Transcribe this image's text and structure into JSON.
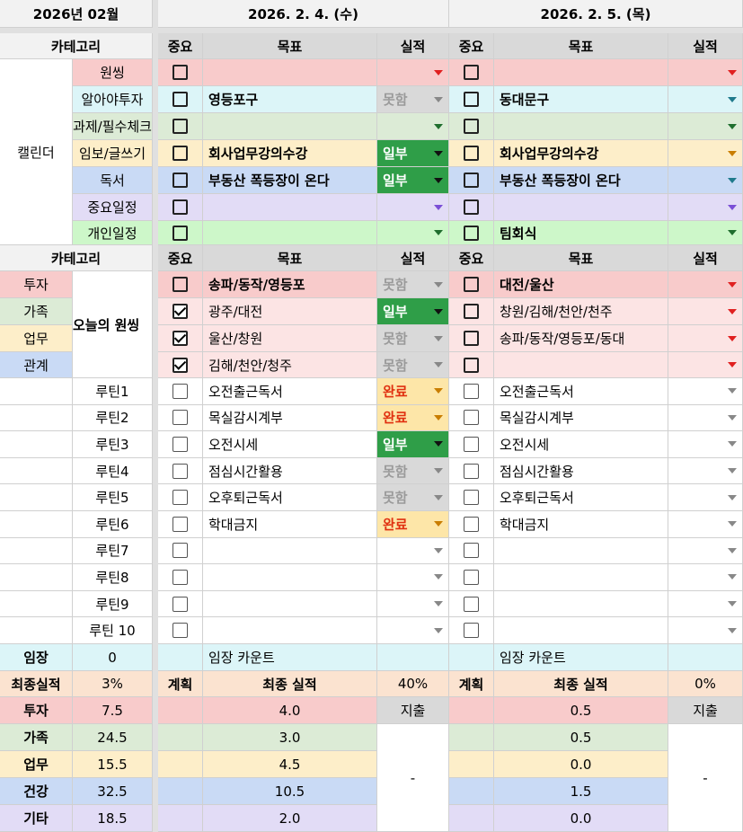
{
  "header": {
    "month": "2026년 02월",
    "day1": "2026. 2. 4. (수)",
    "day2": "2026. 2. 5. (목)"
  },
  "cols": {
    "category": "카테고리",
    "important": "중요",
    "goal": "목표",
    "result": "실적"
  },
  "calendar": {
    "label": "캘린더",
    "rows": [
      {
        "name": "원씽",
        "d1_goal": "",
        "d1_result": "",
        "d2_goal": "",
        "d2_result": ""
      },
      {
        "name": "알아야투자",
        "d1_goal": "영등포구",
        "d1_result": "못함",
        "d2_goal": "동대문구",
        "d2_result": ""
      },
      {
        "name": "과제/필수체크",
        "d1_goal": "",
        "d1_result": "",
        "d2_goal": "",
        "d2_result": ""
      },
      {
        "name": "임보/글쓰기",
        "d1_goal": "회사업무강의수강",
        "d1_result": "일부",
        "d2_goal": "회사업무강의수강",
        "d2_result": ""
      },
      {
        "name": "독서",
        "d1_goal": "부동산 폭등장이 온다",
        "d1_result": "일부",
        "d2_goal": "부동산 폭등장이 온다",
        "d2_result": ""
      },
      {
        "name": "중요일정",
        "d1_goal": "",
        "d1_result": "",
        "d2_goal": "",
        "d2_result": ""
      },
      {
        "name": "개인일정",
        "d1_goal": "",
        "d1_result": "",
        "d2_goal": "팀회식",
        "d2_result": ""
      }
    ]
  },
  "oneThing": {
    "label": "오늘의 원씽",
    "legend": [
      "투자",
      "가족",
      "업무",
      "관계"
    ],
    "rows": [
      {
        "d1_goal": "송파/동작/영등포",
        "d1_result": "못함",
        "d1_checked": false,
        "d2_goal": "대전/울산",
        "d2_checked": false
      },
      {
        "d1_goal": "광주/대전",
        "d1_result": "일부",
        "d1_checked": true,
        "d2_goal": "창원/김해/천안/천주",
        "d2_checked": false
      },
      {
        "d1_goal": "울산/창원",
        "d1_result": "못함",
        "d1_checked": true,
        "d2_goal": "송파/동작/영등포/동대",
        "d2_checked": false
      },
      {
        "d1_goal": "김해/천안/청주",
        "d1_result": "못함",
        "d1_checked": true,
        "d2_goal": "",
        "d2_checked": false
      }
    ]
  },
  "routines": [
    {
      "name": "루틴1",
      "d1_goal": "오전출근독서",
      "d1_result": "완료",
      "d2_goal": "오전출근독서"
    },
    {
      "name": "루틴2",
      "d1_goal": "목실감시계부",
      "d1_result": "완료",
      "d2_goal": "목실감시계부"
    },
    {
      "name": "루틴3",
      "d1_goal": "오전시세",
      "d1_result": "일부",
      "d2_goal": "오전시세"
    },
    {
      "name": "루틴4",
      "d1_goal": "점심시간활용",
      "d1_result": "못함",
      "d2_goal": "점심시간활용"
    },
    {
      "name": "루틴5",
      "d1_goal": "오후퇴근독서",
      "d1_result": "못함",
      "d2_goal": "오후퇴근독서"
    },
    {
      "name": "루틴6",
      "d1_goal": "학대금지",
      "d1_result": "완료",
      "d2_goal": "학대금지"
    },
    {
      "name": "루틴7",
      "d1_goal": "",
      "d1_result": "",
      "d2_goal": ""
    },
    {
      "name": "루틴8",
      "d1_goal": "",
      "d1_result": "",
      "d2_goal": ""
    },
    {
      "name": "루틴9",
      "d1_goal": "",
      "d1_result": "",
      "d2_goal": ""
    },
    {
      "name": "루틴 10",
      "d1_goal": "",
      "d1_result": "",
      "d2_goal": ""
    }
  ],
  "imjang": {
    "label": "임장",
    "value": "0",
    "d1_text": "임장 카운트",
    "d2_text": "임장 카운트"
  },
  "final": {
    "label": "최종실적",
    "value": "3%",
    "plan": "계획",
    "title": "최종 실적",
    "d1_pct": "40%",
    "d2_pct": "0%"
  },
  "summary": [
    {
      "name": "투자",
      "value": "7.5",
      "d1": "4.0",
      "d2": "0.5"
    },
    {
      "name": "가족",
      "value": "24.5",
      "d1": "3.0",
      "d2": "0.5"
    },
    {
      "name": "업무",
      "value": "15.5",
      "d1": "4.5",
      "d2": "0.0"
    },
    {
      "name": "건강",
      "value": "32.5",
      "d1": "10.5",
      "d2": "1.5"
    },
    {
      "name": "기타",
      "value": "18.5",
      "d1": "2.0",
      "d2": "0.0"
    }
  ],
  "expense": {
    "label": "지출",
    "d1": "-",
    "d2": "-"
  },
  "colors": {
    "pink": "#f8cbcb",
    "cyan": "#dcf5f8",
    "green": "#dcebd6",
    "yellow": "#fdeec9",
    "blue": "#c9daf5",
    "lavender": "#e2dcf6",
    "lightgreen": "#cdf7c9",
    "darkgreen": "#2f9e48"
  }
}
